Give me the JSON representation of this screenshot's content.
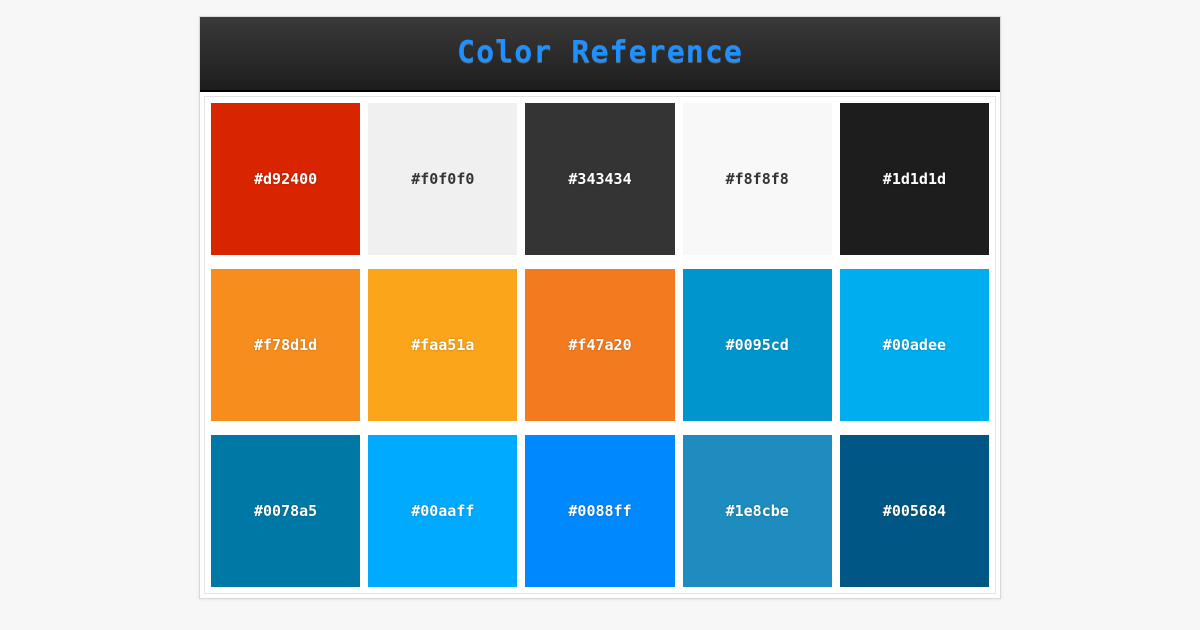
{
  "header": {
    "title": "Color Reference"
  },
  "swatches": [
    [
      {
        "hex": "#d92400",
        "text": "light"
      },
      {
        "hex": "#f0f0f0",
        "text": "dark"
      },
      {
        "hex": "#343434",
        "text": "light"
      },
      {
        "hex": "#f8f8f8",
        "text": "dark"
      },
      {
        "hex": "#1d1d1d",
        "text": "light"
      }
    ],
    [
      {
        "hex": "#f78d1d",
        "text": "light"
      },
      {
        "hex": "#faa51a",
        "text": "light"
      },
      {
        "hex": "#f47a20",
        "text": "light"
      },
      {
        "hex": "#0095cd",
        "text": "light"
      },
      {
        "hex": "#00adee",
        "text": "light"
      }
    ],
    [
      {
        "hex": "#0078a5",
        "text": "light"
      },
      {
        "hex": "#00aaff",
        "text": "light"
      },
      {
        "hex": "#0088ff",
        "text": "light"
      },
      {
        "hex": "#1e8cbe",
        "text": "light"
      },
      {
        "hex": "#005684",
        "text": "light"
      }
    ]
  ]
}
